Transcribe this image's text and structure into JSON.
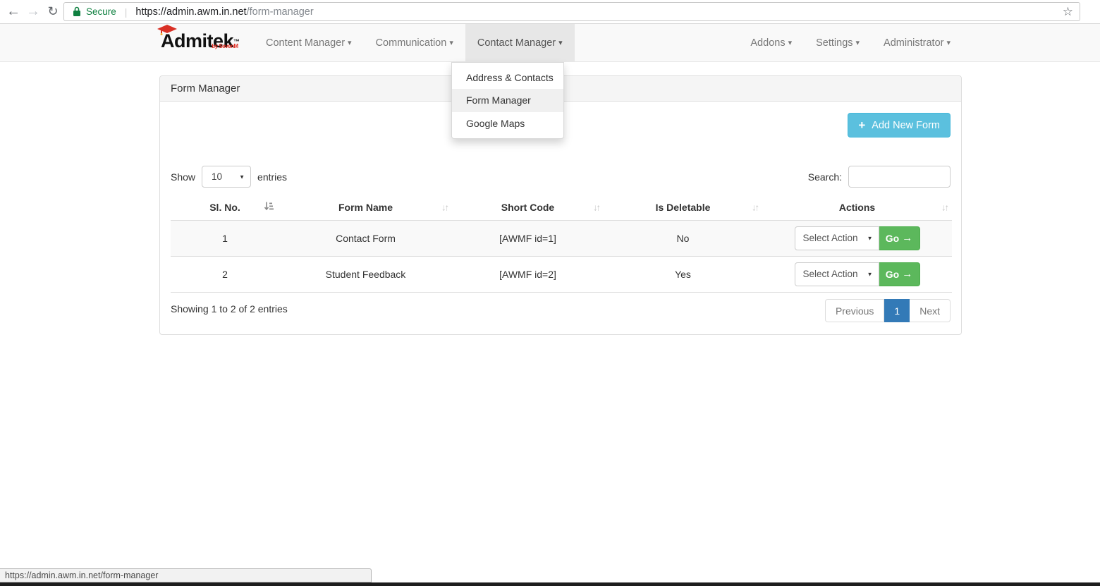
{
  "browser": {
    "secure_label": "Secure",
    "url_host": "https://admin.awm.in.net",
    "url_path": "/form-manager",
    "status_url": "https://admin.awm.in.net/form-manager"
  },
  "logo": {
    "name": "Admitek",
    "tm": "™",
    "tagline": "by SevenM"
  },
  "nav": {
    "items_left": [
      {
        "label": "Content Manager"
      },
      {
        "label": "Communication"
      },
      {
        "label": "Contact Manager"
      }
    ],
    "items_right": [
      {
        "label": "Addons"
      },
      {
        "label": "Settings"
      },
      {
        "label": "Administrator"
      }
    ]
  },
  "contact_dropdown": {
    "items": [
      {
        "label": "Address & Contacts"
      },
      {
        "label": "Form Manager"
      },
      {
        "label": "Google Maps"
      }
    ]
  },
  "panel": {
    "title": "Form Manager",
    "add_button_label": "Add New Form"
  },
  "table_controls": {
    "show_label": "Show",
    "length_value": "10",
    "entries_label": "entries",
    "search_label": "Search:"
  },
  "table": {
    "headers": [
      "Sl. No.",
      "Form Name",
      "Short Code",
      "Is Deletable",
      "Actions"
    ],
    "rows": [
      {
        "sl_no": "1",
        "form_name": "Contact Form",
        "short_code": "[AWMF id=1]",
        "is_deletable": "No",
        "action_value": "Select Action",
        "go_label": "Go"
      },
      {
        "sl_no": "2",
        "form_name": "Student Feedback",
        "short_code": "[AWMF id=2]",
        "is_deletable": "Yes",
        "action_value": "Select Action",
        "go_label": "Go"
      }
    ]
  },
  "table_footer": {
    "showing_text": "Showing 1 to 2 of 2 entries",
    "pagination": {
      "previous": "Previous",
      "current": "1",
      "next": "Next"
    }
  },
  "icons": {
    "back_arrow": "←",
    "forward_arrow": "→",
    "reload": "↻",
    "star": "☆",
    "separator": "|",
    "caret_down": "▾",
    "select_caret": "▼",
    "plus": "+",
    "go_arrow": "→",
    "sort_down": "↓",
    "sort_up": "↑"
  },
  "colors": {
    "add_button": "#5bc0de",
    "go_button": "#5cb85c",
    "pagination_active": "#337ab7",
    "secure_green": "#0f8040",
    "brand_red": "#e02b20"
  }
}
